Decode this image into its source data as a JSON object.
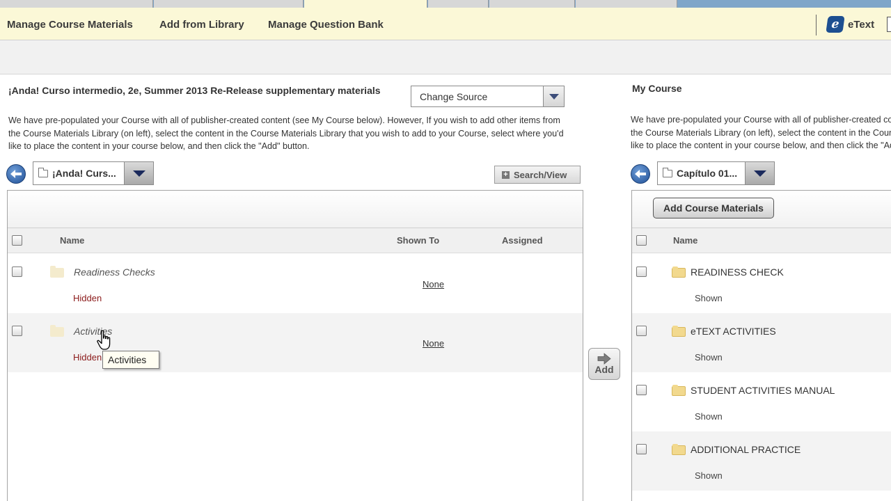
{
  "toolbar": {
    "links": [
      "Manage Course Materials",
      "Add from Library",
      "Manage Question Bank"
    ],
    "etext_label": "eText"
  },
  "library": {
    "title": "¡Anda! Curso intermedio, 2e, Summer 2013 Re-Release supplementary materials",
    "change_source": "Change Source",
    "intro": "We have pre-populated your Course with all of publisher-created content (see My Course below). However, If you wish to add other items from the Course Materials Library (on left), select the content in the Course Materials Library that you wish to add to your Course, select where you'd like to place the content in your course below, and then click the \"Add\" button.",
    "folder_select": "¡Anda! Curs...",
    "search_view": "Search/View",
    "columns": {
      "name": "Name",
      "shown_to": "Shown To",
      "assigned": "Assigned"
    },
    "rows": [
      {
        "name": "Readiness Checks",
        "status": "Hidden",
        "shown_to": "None"
      },
      {
        "name": "Activities",
        "status": "Hidden",
        "shown_to": "None"
      }
    ],
    "tooltip": "Activities"
  },
  "add_button": "Add",
  "my_course": {
    "title": "My Course",
    "intro": "We have pre-populated your Course with all of publisher-created content (see My Course below). However, If you wish to add other items from the Course Materials Library (on left), select the content in the Course Materials Library that you wish to add to your Course, select where you'd like to place the content in your course below, and then click the \"Add\" button.",
    "folder_select": "Capítulo 01...",
    "add_materials": "Add Course Materials",
    "columns": {
      "name": "Name"
    },
    "rows": [
      {
        "name": "READINESS CHECK",
        "status": "Shown"
      },
      {
        "name": "eTEXT ACTIVITIES",
        "status": "Shown"
      },
      {
        "name": "STUDENT ACTIVITIES MANUAL",
        "status": "Shown"
      },
      {
        "name": "ADDITIONAL PRACTICE",
        "status": "Shown"
      }
    ]
  }
}
